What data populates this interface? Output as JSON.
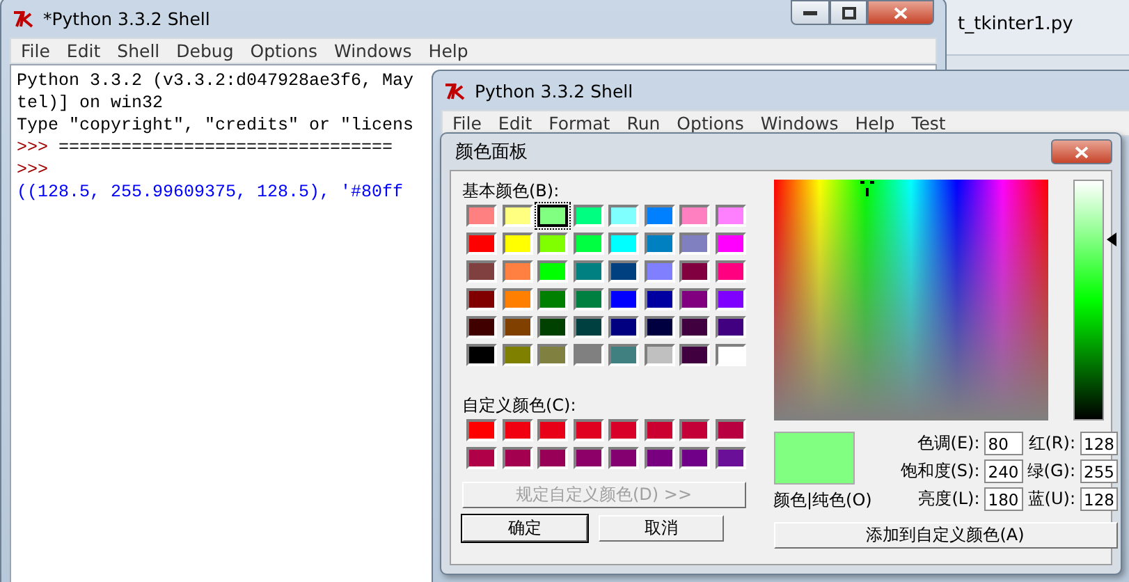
{
  "back_window": {
    "title": "t_tkinter1.py"
  },
  "shell_window": {
    "title": "*Python 3.3.2 Shell",
    "menu": [
      "File",
      "Edit",
      "Shell",
      "Debug",
      "Options",
      "Windows",
      "Help"
    ],
    "lines": [
      {
        "kind": "output",
        "text": "Python 3.3.2 (v3.3.2:d047928ae3f6, May"
      },
      {
        "kind": "output",
        "text": "tel)] on win32"
      },
      {
        "kind": "output",
        "text": "Type \"copyright\", \"credits\" or \"licens"
      },
      {
        "kind": "input",
        "prompt": ">>>",
        "text": "================================"
      },
      {
        "kind": "input",
        "prompt": ">>>"
      },
      {
        "kind": "result",
        "text": "((128.5, 255.99609375, 128.5), '#80ff"
      }
    ]
  },
  "editor_window": {
    "title": "Python 3.3.2 Shell",
    "menu": [
      "File",
      "Edit",
      "Format",
      "Run",
      "Options",
      "Windows",
      "Help",
      "Test"
    ]
  },
  "dialog": {
    "title": "颜色面板",
    "basic_label": "基本颜色(B):",
    "basic_colors": [
      {
        "color": "#ff8080",
        "selected": false
      },
      {
        "color": "#ffff80",
        "selected": false
      },
      {
        "color": "#80ff80",
        "selected": true
      },
      {
        "color": "#00ff80",
        "selected": false
      },
      {
        "color": "#80ffff",
        "selected": false
      },
      {
        "color": "#0080ff",
        "selected": false
      },
      {
        "color": "#ff80c0",
        "selected": false
      },
      {
        "color": "#ff80ff",
        "selected": false
      },
      {
        "color": "#ff0000",
        "selected": false
      },
      {
        "color": "#ffff00",
        "selected": false
      },
      {
        "color": "#80ff00",
        "selected": false
      },
      {
        "color": "#00ff40",
        "selected": false
      },
      {
        "color": "#00ffff",
        "selected": false
      },
      {
        "color": "#0080c0",
        "selected": false
      },
      {
        "color": "#8080c0",
        "selected": false
      },
      {
        "color": "#ff00ff",
        "selected": false
      },
      {
        "color": "#804040",
        "selected": false
      },
      {
        "color": "#ff8040",
        "selected": false
      },
      {
        "color": "#00ff00",
        "selected": false
      },
      {
        "color": "#008080",
        "selected": false
      },
      {
        "color": "#004080",
        "selected": false
      },
      {
        "color": "#8080ff",
        "selected": false
      },
      {
        "color": "#800040",
        "selected": false
      },
      {
        "color": "#ff0080",
        "selected": false
      },
      {
        "color": "#800000",
        "selected": false
      },
      {
        "color": "#ff8000",
        "selected": false
      },
      {
        "color": "#008000",
        "selected": false
      },
      {
        "color": "#008040",
        "selected": false
      },
      {
        "color": "#0000ff",
        "selected": false
      },
      {
        "color": "#0000a0",
        "selected": false
      },
      {
        "color": "#800080",
        "selected": false
      },
      {
        "color": "#8000ff",
        "selected": false
      },
      {
        "color": "#400000",
        "selected": false
      },
      {
        "color": "#804000",
        "selected": false
      },
      {
        "color": "#004000",
        "selected": false
      },
      {
        "color": "#004040",
        "selected": false
      },
      {
        "color": "#000080",
        "selected": false
      },
      {
        "color": "#000040",
        "selected": false
      },
      {
        "color": "#400040",
        "selected": false
      },
      {
        "color": "#400080",
        "selected": false
      },
      {
        "color": "#000000",
        "selected": false
      },
      {
        "color": "#808000",
        "selected": false
      },
      {
        "color": "#808040",
        "selected": false
      },
      {
        "color": "#808080",
        "selected": false
      },
      {
        "color": "#408080",
        "selected": false
      },
      {
        "color": "#c0c0c0",
        "selected": false
      },
      {
        "color": "#400040",
        "selected": false
      },
      {
        "color": "#ffffff",
        "selected": false
      }
    ],
    "custom_label": "自定义颜色(C):",
    "custom_colors": [
      {
        "color": "#ff0000"
      },
      {
        "color": "#f00010"
      },
      {
        "color": "#e80018"
      },
      {
        "color": "#e00020"
      },
      {
        "color": "#d80028"
      },
      {
        "color": "#cc0030"
      },
      {
        "color": "#c40038"
      },
      {
        "color": "#b80040"
      },
      {
        "color": "#b00048"
      },
      {
        "color": "#a40050"
      },
      {
        "color": "#980058"
      },
      {
        "color": "#8c0068"
      },
      {
        "color": "#840070"
      },
      {
        "color": "#780080"
      },
      {
        "color": "#700088"
      },
      {
        "color": "#6a1098"
      }
    ],
    "define_button": {
      "label": "规定自定义颜色(D) >>",
      "disabled": true
    },
    "ok_button": "确定",
    "cancel_button": "取消",
    "luminance": {
      "level": 0.75
    },
    "preview": {
      "color": "#80ff80",
      "label": "颜色|纯色(O)"
    },
    "fields": [
      {
        "label": "色调(E):",
        "value": "80"
      },
      {
        "label": "红(R):",
        "value": "128"
      },
      {
        "label": "饱和度(S):",
        "value": "240"
      },
      {
        "label": "绿(G):",
        "value": "255"
      },
      {
        "label": "亮度(L):",
        "value": "180"
      },
      {
        "label": "蓝(U):",
        "value": "128"
      }
    ],
    "add_button": "添加到自定义颜色(A)"
  }
}
